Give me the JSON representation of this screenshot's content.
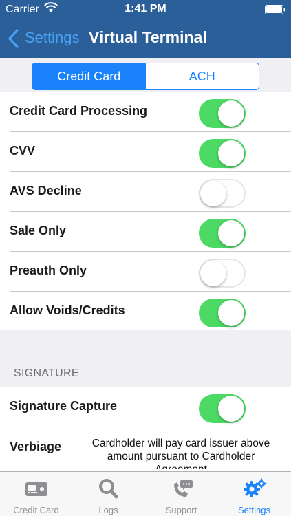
{
  "status_bar": {
    "carrier": "Carrier",
    "time": "1:41 PM"
  },
  "nav": {
    "back_label": "Settings",
    "title": "Virtual Terminal"
  },
  "segments": [
    {
      "label": "Credit Card",
      "selected": true
    },
    {
      "label": "ACH",
      "selected": false
    }
  ],
  "settings": [
    {
      "label": "Credit Card Processing",
      "on": true
    },
    {
      "label": "CVV",
      "on": true
    },
    {
      "label": "AVS Decline",
      "on": false
    },
    {
      "label": "Sale Only",
      "on": true
    },
    {
      "label": "Preauth Only",
      "on": false
    },
    {
      "label": "Allow Voids/Credits",
      "on": true
    }
  ],
  "signature_section": {
    "header": "SIGNATURE",
    "capture_label": "Signature Capture",
    "capture_on": true,
    "verbiage_label": "Verbiage",
    "verbiage_text": "Cardholder will pay card issuer above amount pursuant to Cardholder Agreement"
  },
  "tabs": [
    {
      "label": "Credit Card",
      "icon": "credit-card-reader-icon",
      "active": false
    },
    {
      "label": "Logs",
      "icon": "search-icon",
      "active": false
    },
    {
      "label": "Support",
      "icon": "phone-chat-icon",
      "active": false
    },
    {
      "label": "Settings",
      "icon": "gears-icon",
      "active": true
    }
  ],
  "colors": {
    "nav_background": "#2b5f9a",
    "accent": "#1a82fb",
    "toggle_on": "#4cd964",
    "tab_inactive": "#8e8e93"
  }
}
